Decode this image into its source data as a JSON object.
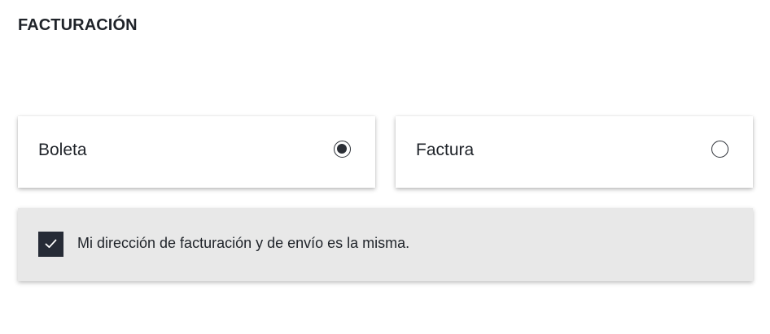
{
  "billing": {
    "title": "FACTURACIÓN",
    "options": [
      {
        "label": "Boleta",
        "selected": true
      },
      {
        "label": "Factura",
        "selected": false
      }
    ],
    "same_address": {
      "label": "Mi dirección de facturación y de envío es la misma.",
      "checked": true,
      "icon": "check-icon"
    },
    "colors": {
      "accent": "#2b2f36",
      "checkbox_bg": "#262b36",
      "panel_bg": "#e8e8e8"
    }
  }
}
